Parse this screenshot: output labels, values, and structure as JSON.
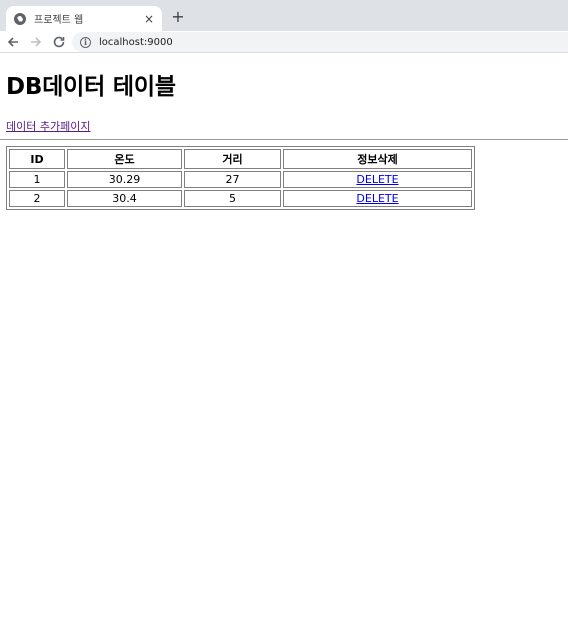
{
  "browser": {
    "tab_title": "프로젝트 웹",
    "tab_close": "×",
    "new_tab": "+",
    "url": "localhost:9000"
  },
  "page": {
    "title": "DB데이터 테이블",
    "add_link": "데이터 추가페이지"
  },
  "table": {
    "headers": [
      "ID",
      "온도",
      "거리",
      "정보삭제"
    ],
    "rows": [
      {
        "id": "1",
        "temp": "30.29",
        "distance": "27",
        "action": "DELETE"
      },
      {
        "id": "2",
        "temp": "30.4",
        "distance": "5",
        "action": "DELETE"
      }
    ]
  }
}
